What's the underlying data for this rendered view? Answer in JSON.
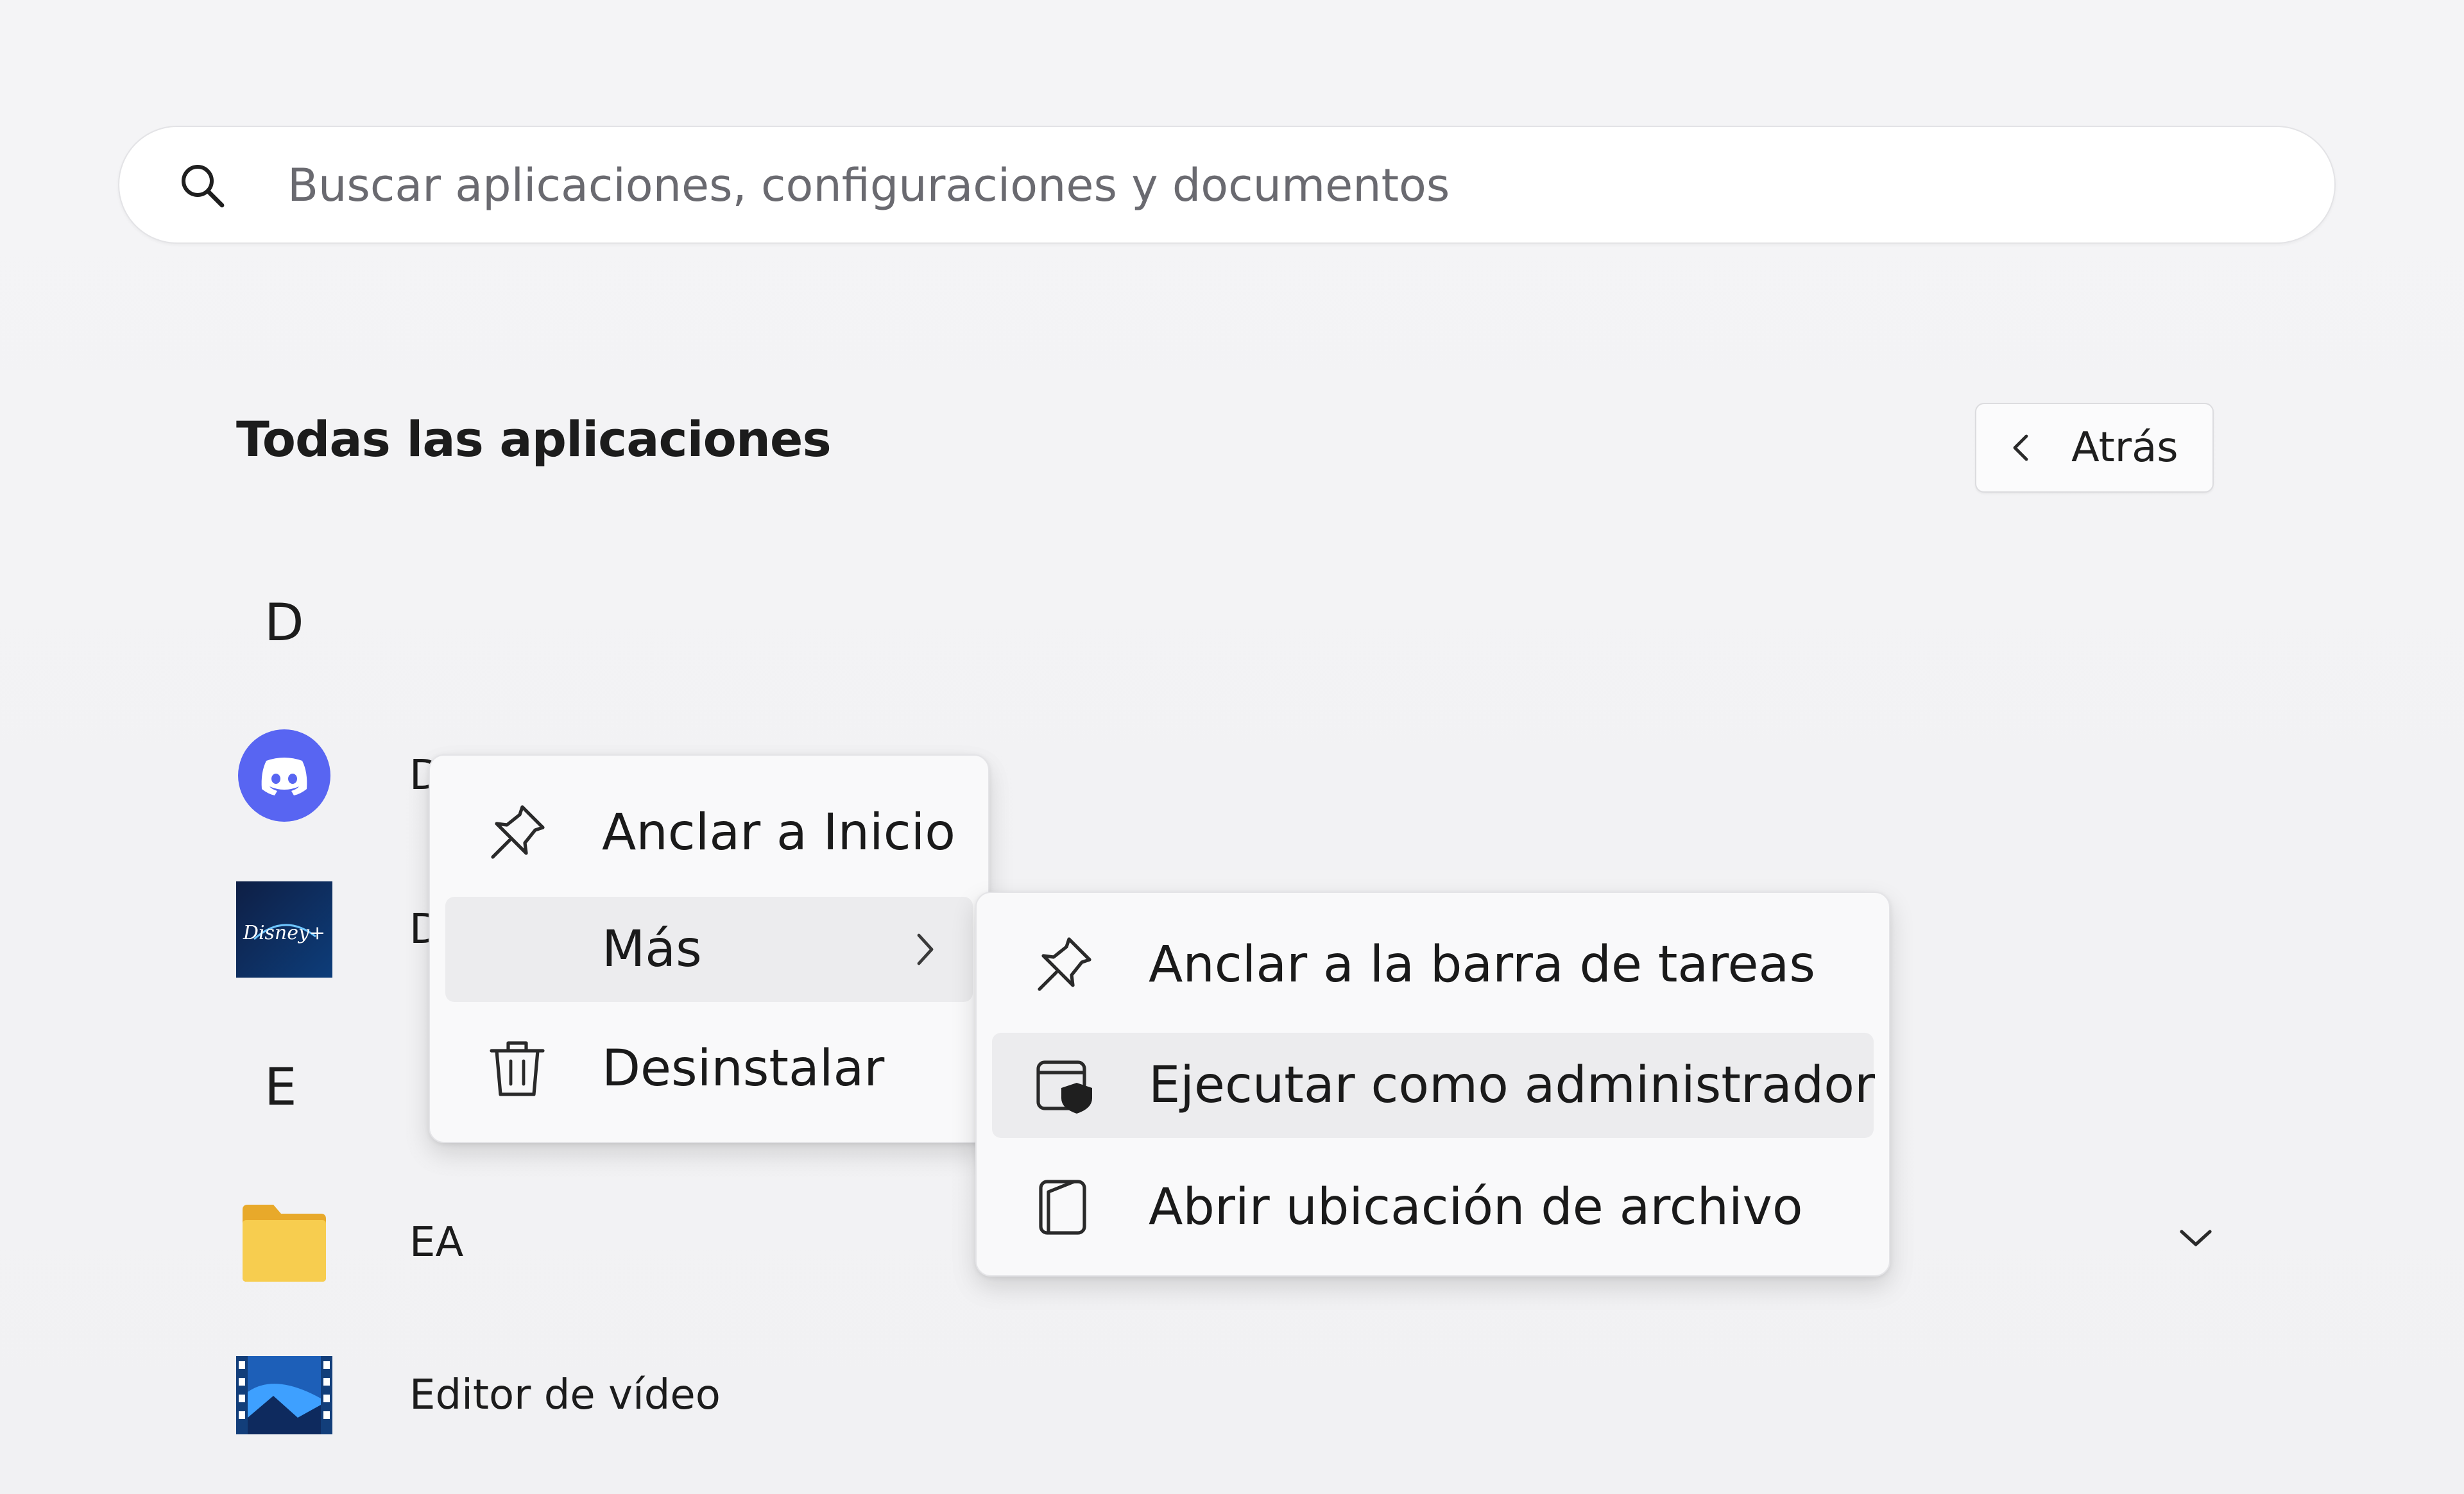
{
  "search": {
    "placeholder": "Buscar aplicaciones, configuraciones y documentos",
    "icon": "search-icon"
  },
  "header": {
    "title": "Todas las aplicaciones",
    "back_label": "Atrás",
    "back_icon": "chevron-left-icon"
  },
  "app_list": {
    "groups": [
      {
        "letter": "D",
        "apps": [
          {
            "name": "D",
            "icon": "discord-icon"
          },
          {
            "name": "D",
            "icon": "disney-plus-icon"
          }
        ]
      },
      {
        "letter": "E",
        "apps": [
          {
            "name": "EA",
            "icon": "folder-icon",
            "expandable": true
          },
          {
            "name": "Editor de vídeo",
            "icon": "video-editor-icon"
          }
        ]
      }
    ]
  },
  "context_menu": {
    "items": [
      {
        "label": "Anclar a Inicio",
        "icon": "pin-icon"
      },
      {
        "label": "Más",
        "icon": "",
        "submenu": true,
        "highlighted": true
      },
      {
        "label": "Desinstalar",
        "icon": "trash-icon"
      }
    ]
  },
  "submenu": {
    "items": [
      {
        "label": "Anclar a la barra de tareas",
        "icon": "pin-icon"
      },
      {
        "label": "Ejecutar como administrador",
        "icon": "admin-shield-icon",
        "highlighted": true
      },
      {
        "label": "Abrir ubicación de archivo",
        "icon": "open-file-location-icon"
      }
    ]
  },
  "colors": {
    "discord": "#5865f2",
    "disney": "#0b2a5b",
    "folder": "#f6c94a",
    "video_editor": "#1c6fd6"
  }
}
